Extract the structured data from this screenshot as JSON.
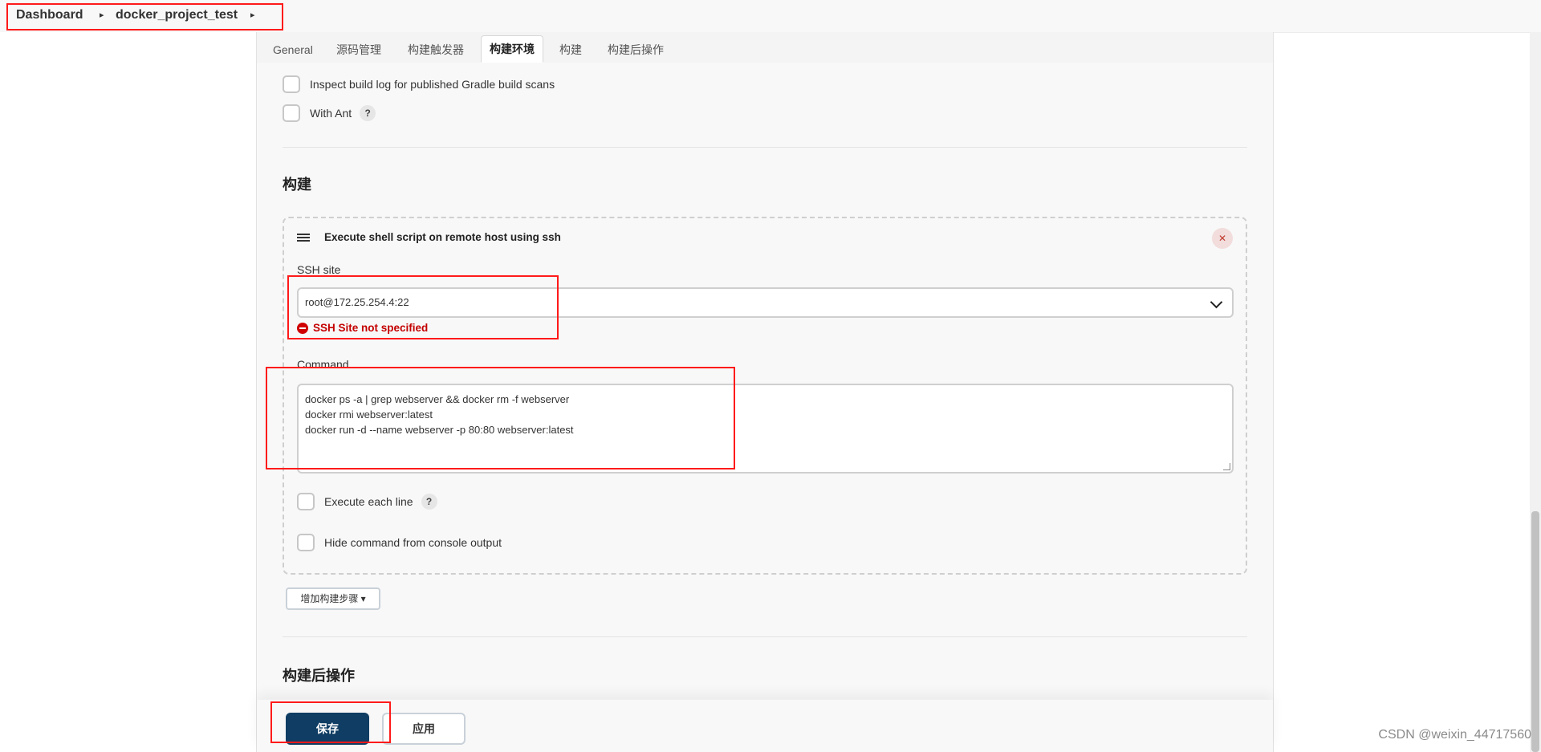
{
  "breadcrumb": {
    "items": [
      "Dashboard",
      "docker_project_test"
    ]
  },
  "tabs": [
    {
      "label": "General"
    },
    {
      "label": "源码管理"
    },
    {
      "label": "构建触发器"
    },
    {
      "label": "构建环境"
    },
    {
      "label": "构建"
    },
    {
      "label": "构建后操作"
    }
  ],
  "build_env": {
    "gradle_scan_label": "Inspect build log for published Gradle build scans",
    "with_ant_label": "With Ant",
    "help_glyph": "?"
  },
  "build_section": {
    "title": "构建",
    "step": {
      "title": "Execute shell script on remote host using ssh",
      "ssh_site_label": "SSH site",
      "ssh_site_value": "root@172.25.254.4:22",
      "error_text": "SSH Site not specified",
      "command_label": "Command",
      "command_lines": [
        "docker ps -a | grep webserver && docker rm -f webserver",
        "docker rmi webserver:latest",
        "docker run -d --name webserver -p 80:80 webserver:latest"
      ],
      "execute_each_line_label": "Execute each line",
      "hide_command_label": "Hide command from console output"
    },
    "add_step_label": "增加构建步骤 ▾"
  },
  "post_build": {
    "title": "构建后操作"
  },
  "footer": {
    "save_label": "保存",
    "apply_label": "应用"
  },
  "watermark": "CSDN @weixin_44717560",
  "colors": {
    "primary": "#0f3d63",
    "error": "#c40000",
    "annotation": "#ff1a1a"
  }
}
